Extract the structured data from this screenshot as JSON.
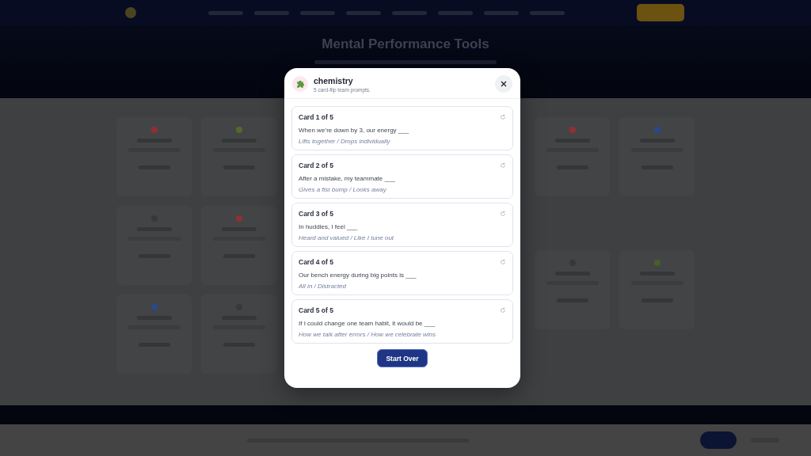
{
  "page": {
    "title": "Mental Performance Tools"
  },
  "modal": {
    "title": "chemistry",
    "subtitle": "5 card-flip team prompts.",
    "cards": [
      {
        "label": "Card 1 of 5",
        "prompt": "When we’re down by 3, our energy ___",
        "options": "Lifts together / Drops individually"
      },
      {
        "label": "Card 2 of 5",
        "prompt": "After a mistake, my teammate ___",
        "options": "Gives a fist bump / Looks away"
      },
      {
        "label": "Card 3 of 5",
        "prompt": "In huddles, I feel ___",
        "options": "Heard and valued / Like I tune out"
      },
      {
        "label": "Card 4 of 5",
        "prompt": "Our bench energy during big points is ___",
        "options": "All in / Distracted"
      },
      {
        "label": "Card 5 of 5",
        "prompt": "If I could change one team habit, it would be ___",
        "options": "How we talk after errors / How we celebrate wins"
      }
    ],
    "button": "Start Over"
  }
}
